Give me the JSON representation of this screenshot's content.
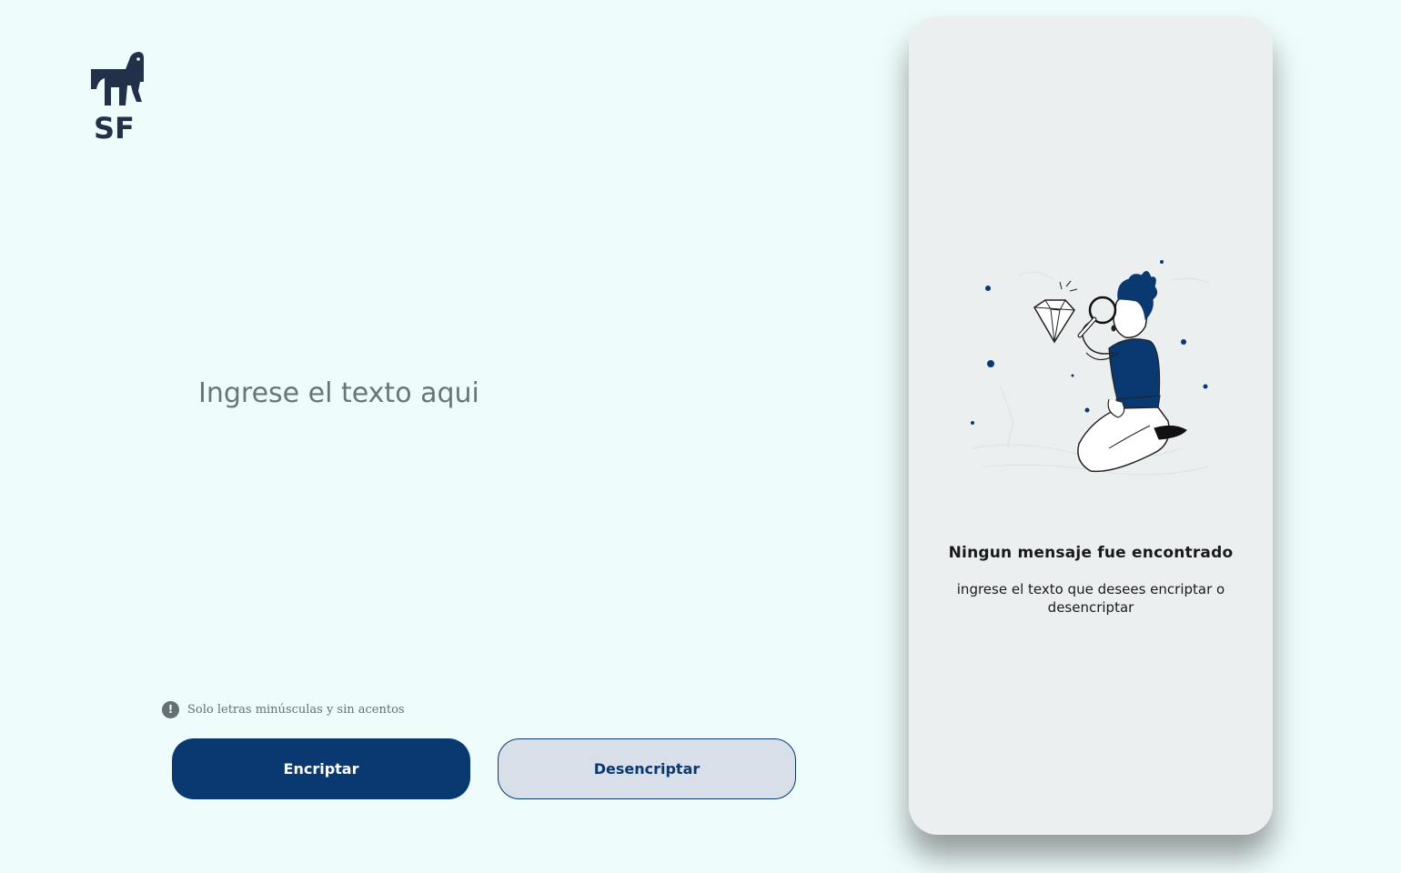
{
  "logo": {
    "text": "SF",
    "icon": "dog-logo-icon"
  },
  "input": {
    "placeholder": "Ingrese el texto aqui",
    "value": ""
  },
  "hint": {
    "icon": "exclamation-circle-icon",
    "text": "Solo letras minúsculas y sin acentos"
  },
  "buttons": {
    "encrypt_label": "Encriptar",
    "decrypt_label": "Desencriptar"
  },
  "output": {
    "title": "Ningun mensaje fue encontrado",
    "subtitle": "ingrese el texto que desees encriptar o desencriptar",
    "illustration": "person-magnifying-glass-diamond-illustration"
  },
  "colors": {
    "background": "#effcfc",
    "primary": "#0a3871",
    "panel": "#eceff0",
    "secondary_button": "#d8dfe8",
    "hint": "#666f74"
  }
}
